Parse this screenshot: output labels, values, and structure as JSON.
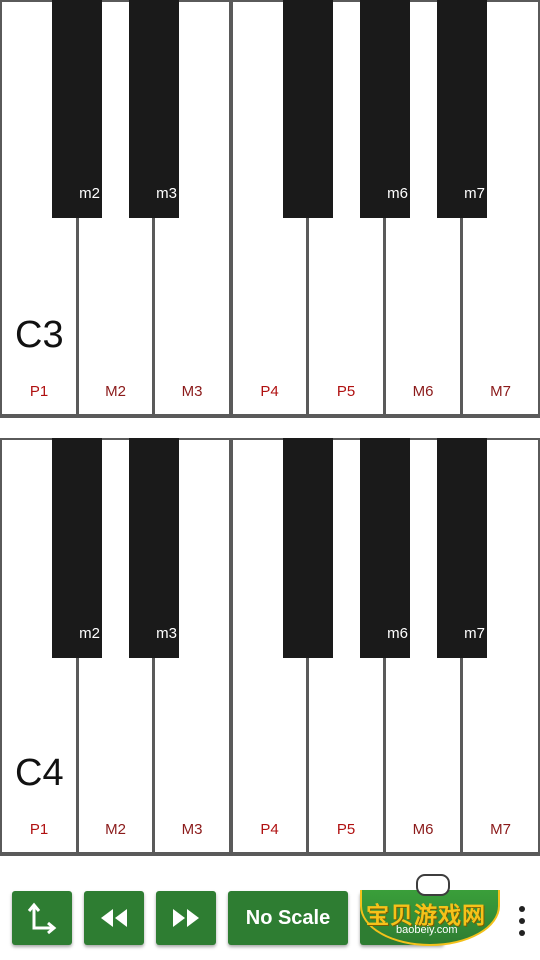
{
  "piano": {
    "octaves": [
      {
        "name": "C3",
        "black_keys": [
          "m2",
          "m3",
          "",
          "m6",
          "m7"
        ],
        "white_keys": [
          "P1",
          "M2",
          "M3",
          "P4",
          "P5",
          "M6",
          "M7"
        ]
      },
      {
        "name": "C4",
        "black_keys": [
          "m2",
          "m3",
          "",
          "m6",
          "m7"
        ],
        "white_keys": [
          "P1",
          "M2",
          "M3",
          "P4",
          "P5",
          "M6",
          "M7"
        ]
      }
    ]
  },
  "toolbar": {
    "scale_label": "No Scale",
    "icons": [
      "axis-icon",
      "rewind-icon",
      "fast-forward-icon",
      "more-vert-icon"
    ]
  },
  "watermark": {
    "text": "宝贝游戏网",
    "sub": "baobeiy.com"
  },
  "colors": {
    "button_green": "#2e7d32",
    "interval_red": "#8b1a1a",
    "black_key": "#1a1a1a"
  }
}
